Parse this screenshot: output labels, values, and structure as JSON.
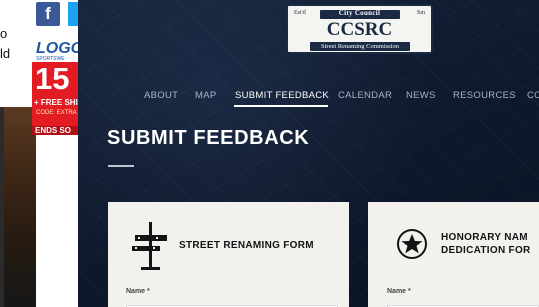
{
  "left_column": {
    "text_lines": [
      "o",
      "ld"
    ]
  },
  "social": {
    "facebook_label": "f"
  },
  "ad": {
    "logo_text": "LOGO",
    "logo_sub": "SPORTSWE",
    "discount": "15",
    "shipping": "+ FREE SHIPP",
    "code": "CODE: EXTRA",
    "ends": "ENDS SO"
  },
  "logo_badge": {
    "top_text": "City Council",
    "left_small": "Est'd",
    "right_small": "Sm",
    "acronym": "CCSRC",
    "subtitle": "Street Renaming Commission"
  },
  "nav": {
    "items": [
      {
        "label": "ABOUT"
      },
      {
        "label": "MAP"
      },
      {
        "label": "SUBMIT FEEDBACK",
        "active": true
      },
      {
        "label": "CALENDAR"
      },
      {
        "label": "NEWS"
      },
      {
        "label": "RESOURCES"
      },
      {
        "label": "CO"
      }
    ]
  },
  "page": {
    "title": "SUBMIT FEEDBACK"
  },
  "cards": [
    {
      "title_line1": "STREET RENAMING FORM",
      "title_line2": "",
      "name_label": "Name *",
      "icon": "street-sign-icon"
    },
    {
      "title_line1": "HONORARY NAM",
      "title_line2": "DEDICATION FOR",
      "name_label": "Name *",
      "icon": "star-badge-icon"
    }
  ],
  "colors": {
    "page_bg": "#0f1a2e",
    "card_bg": "#f2f1ee",
    "nav_text": "#a8b2c5",
    "ad_red": "#e31b23",
    "facebook": "#3b5998",
    "twitter": "#1da1f2"
  }
}
